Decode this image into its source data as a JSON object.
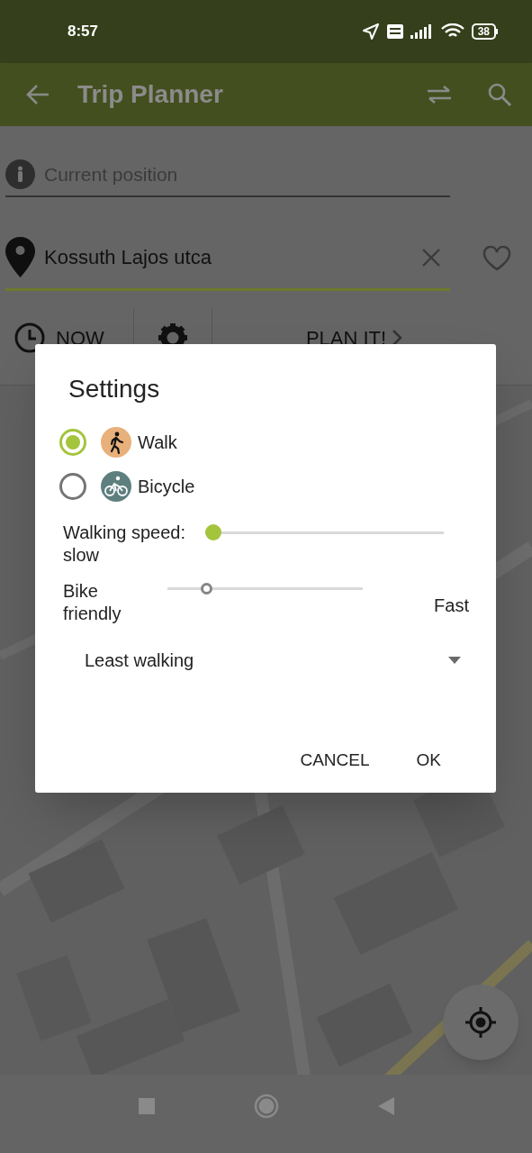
{
  "status_bar": {
    "time": "8:57",
    "battery": "38"
  },
  "app_bar": {
    "title": "Trip Planner"
  },
  "origin": {
    "placeholder": "Current position"
  },
  "destination": {
    "value": "Kossuth Lajos utca"
  },
  "toolbar": {
    "time_button": "NOW",
    "plan_button": "PLAN IT!"
  },
  "dialog": {
    "title": "Settings",
    "modes": [
      {
        "label": "Walk",
        "kind": "walk",
        "selected": true
      },
      {
        "label": "Bicycle",
        "kind": "bicycle",
        "selected": false
      }
    ],
    "sliders": [
      {
        "label": "Walking speed: slow",
        "level": 0,
        "disabled": false
      },
      {
        "label": "Bike friendly",
        "level": 0.2,
        "disabled": true,
        "end_label": "Fast"
      }
    ],
    "dropdown": {
      "value": "Least walking"
    },
    "buttons": [
      "CANCEL",
      "OK"
    ]
  }
}
